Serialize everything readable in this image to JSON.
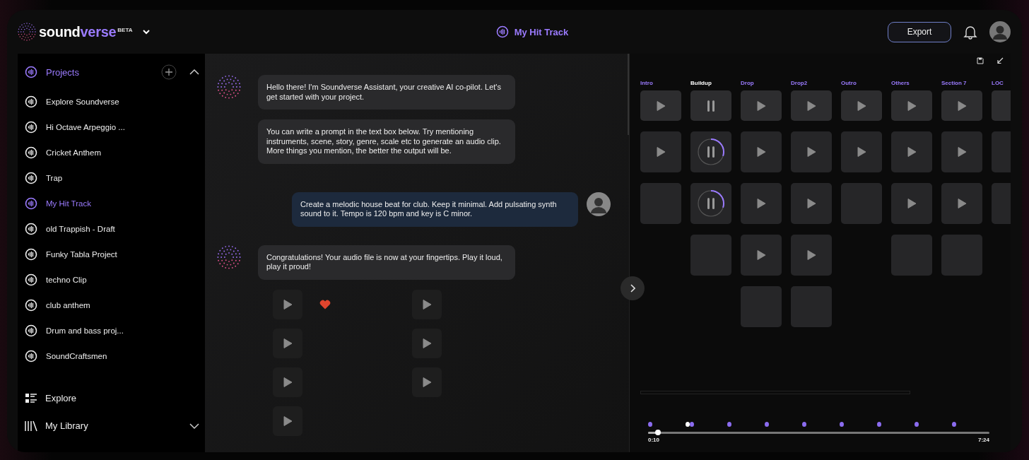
{
  "brand": {
    "name_start": "sound",
    "name_end": "verse",
    "badge": "BETA"
  },
  "header": {
    "track_title": "My Hit Track",
    "export_label": "Export"
  },
  "sidebar": {
    "projects": {
      "label": "Projects",
      "expanded": true,
      "items": [
        {
          "label": "Explore Soundverse",
          "selected": false
        },
        {
          "label": "Hi Octave Arpeggio ...",
          "selected": false
        },
        {
          "label": "Cricket Anthem",
          "selected": false
        },
        {
          "label": "Trap",
          "selected": false
        },
        {
          "label": "My Hit Track",
          "selected": true
        },
        {
          "label": "old Trappish - Draft",
          "selected": false
        },
        {
          "label": "Funky Tabla Project",
          "selected": false
        },
        {
          "label": "techno Clip",
          "selected": false
        },
        {
          "label": "club anthem",
          "selected": false
        },
        {
          "label": "Drum and bass proj...",
          "selected": false
        },
        {
          "label": "SoundCraftsmen",
          "selected": false
        }
      ]
    },
    "links": [
      {
        "kind": "explore",
        "label": "Explore"
      },
      {
        "kind": "library",
        "label": "My Library"
      }
    ]
  },
  "conversation": [
    {
      "kind": "assistant",
      "messages": [
        "Hello there! I'm Soundverse Assistant, your creative AI co-pilot. Let's get started with your project.",
        "You can write a prompt in the text box below. Try mentioning instruments, scene, story, genre, scale etc to generate an audio clip. More things you mention, the better the output will be."
      ]
    },
    {
      "kind": "user",
      "messages": [
        "Create a melodic house beat for club. Keep it minimal. Add pulsating synth sound to it. Tempo is 120 bpm and key is C minor."
      ]
    },
    {
      "kind": "assistant",
      "messages": [
        "Congratulations! Your audio file is now at your fingertips. Play it loud, play it proud!"
      ],
      "clips": [
        {
          "liked": true
        },
        {
          "liked": false
        },
        {
          "liked": false
        },
        {
          "liked": false
        },
        {
          "liked": false
        },
        {
          "liked": false
        },
        {
          "liked": false
        }
      ]
    }
  ],
  "sections": [
    {
      "label": "Intro",
      "selected": false,
      "cells": [
        {
          "kind": "play"
        },
        {
          "kind": "play"
        },
        {
          "kind": "empty"
        }
      ]
    },
    {
      "label": "Buildup",
      "selected": true,
      "cells": [
        {
          "kind": "pause"
        },
        {
          "kind": "playing"
        },
        {
          "kind": "playing"
        },
        {
          "kind": "empty"
        }
      ]
    },
    {
      "label": "Drop",
      "selected": false,
      "cells": [
        {
          "kind": "play"
        },
        {
          "kind": "play"
        },
        {
          "kind": "play"
        },
        {
          "kind": "play"
        },
        {
          "kind": "empty"
        }
      ]
    },
    {
      "label": "Drop2",
      "selected": false,
      "cells": [
        {
          "kind": "play"
        },
        {
          "kind": "play"
        },
        {
          "kind": "play"
        },
        {
          "kind": "play"
        },
        {
          "kind": "empty"
        }
      ]
    },
    {
      "label": "Outro",
      "selected": false,
      "cells": [
        {
          "kind": "play"
        },
        {
          "kind": "play"
        },
        {
          "kind": "empty"
        }
      ]
    },
    {
      "label": "Others",
      "selected": false,
      "cells": [
        {
          "kind": "play"
        },
        {
          "kind": "play"
        },
        {
          "kind": "play"
        },
        {
          "kind": "empty"
        }
      ]
    },
    {
      "label": "Section 7",
      "selected": false,
      "cells": [
        {
          "kind": "play"
        },
        {
          "kind": "play"
        },
        {
          "kind": "play"
        },
        {
          "kind": "empty"
        }
      ]
    },
    {
      "label": "LOC",
      "selected": false,
      "cells": [
        {
          "kind": "empty"
        },
        {
          "kind": "empty"
        },
        {
          "kind": "empty"
        }
      ]
    }
  ],
  "timeline": {
    "markers": [
      {
        "selected": false
      },
      {
        "selected": true
      },
      {
        "selected": false
      },
      {
        "selected": false
      },
      {
        "selected": false
      },
      {
        "selected": false
      },
      {
        "selected": false
      },
      {
        "selected": false
      },
      {
        "selected": false
      },
      {
        "selected": false
      }
    ],
    "level": 0.03,
    "start_time": "0:10",
    "end_time": "7:24"
  }
}
